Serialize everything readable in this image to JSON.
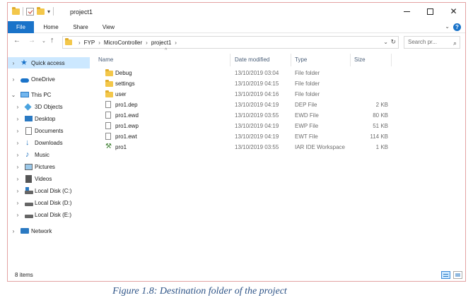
{
  "window": {
    "title": "project1",
    "qat_dropdown": "▾",
    "controls": {
      "close": "✕"
    }
  },
  "ribbon": {
    "tabs": [
      "File",
      "Home",
      "Share",
      "View"
    ],
    "expand": "⌄",
    "help": "?"
  },
  "navigation": {
    "back": "←",
    "forward": "→",
    "recent": "⌄",
    "up": "↑",
    "address": [
      "FYP",
      "MicroController",
      "project1"
    ],
    "address_separator": "›",
    "address_dropdown": "⌄",
    "refresh": "↻",
    "search_placeholder": "Search pr...",
    "search_icon": "⌕"
  },
  "nav_pane": {
    "items": [
      {
        "label": "Quick access",
        "icon": "star-icon",
        "selected": true
      },
      {
        "label": "OneDrive",
        "icon": "cloud-icon"
      },
      {
        "label": "This PC",
        "icon": "computer-icon",
        "expanded": true
      },
      {
        "label": "3D Objects",
        "icon": "cube-icon"
      },
      {
        "label": "Desktop",
        "icon": "desktop-icon"
      },
      {
        "label": "Documents",
        "icon": "document-icon"
      },
      {
        "label": "Downloads",
        "icon": "download-icon"
      },
      {
        "label": "Music",
        "icon": "music-icon"
      },
      {
        "label": "Pictures",
        "icon": "picture-icon"
      },
      {
        "label": "Videos",
        "icon": "video-icon"
      },
      {
        "label": "Local Disk (C:)",
        "icon": "disk-icon"
      },
      {
        "label": "Local Disk (D:)",
        "icon": "disk-icon"
      },
      {
        "label": "Local Disk (E:)",
        "icon": "disk-icon"
      },
      {
        "label": "Network",
        "icon": "network-icon"
      }
    ]
  },
  "file_list": {
    "sort_indicator": "^",
    "columns": [
      "Name",
      "Date modified",
      "Type",
      "Size"
    ],
    "rows": [
      {
        "name": "Debug",
        "date": "13/10/2019 03:04",
        "type": "File folder",
        "size": "",
        "icon": "folder-icon"
      },
      {
        "name": "settings",
        "date": "13/10/2019 04:15",
        "type": "File folder",
        "size": "",
        "icon": "folder-icon"
      },
      {
        "name": "user",
        "date": "13/10/2019 04:16",
        "type": "File folder",
        "size": "",
        "icon": "folder-icon"
      },
      {
        "name": "pro1.dep",
        "date": "13/10/2019 04:19",
        "type": "DEP File",
        "size": "2 KB",
        "icon": "file-icon"
      },
      {
        "name": "pro1.ewd",
        "date": "13/10/2019 03:55",
        "type": "EWD File",
        "size": "80 KB",
        "icon": "file-icon"
      },
      {
        "name": "pro1.ewp",
        "date": "13/10/2019 04:19",
        "type": "EWP File",
        "size": "51 KB",
        "icon": "file-icon"
      },
      {
        "name": "pro1.ewt",
        "date": "13/10/2019 04:19",
        "type": "EWT File",
        "size": "114 KB",
        "icon": "file-icon"
      },
      {
        "name": "pro1",
        "date": "13/10/2019 03:55",
        "type": "IAR IDE Workspace",
        "size": "1 KB",
        "icon": "iar-workspace-icon"
      }
    ]
  },
  "status": {
    "item_count": "8 items"
  },
  "caption": "Figure 1.8: Destination folder of the project",
  "colors": {
    "accent": "#1a73c9",
    "folder": "#f3c74a",
    "selection": "#cce8ff",
    "caption": "#2e5487",
    "border": "#e3a2a2"
  }
}
